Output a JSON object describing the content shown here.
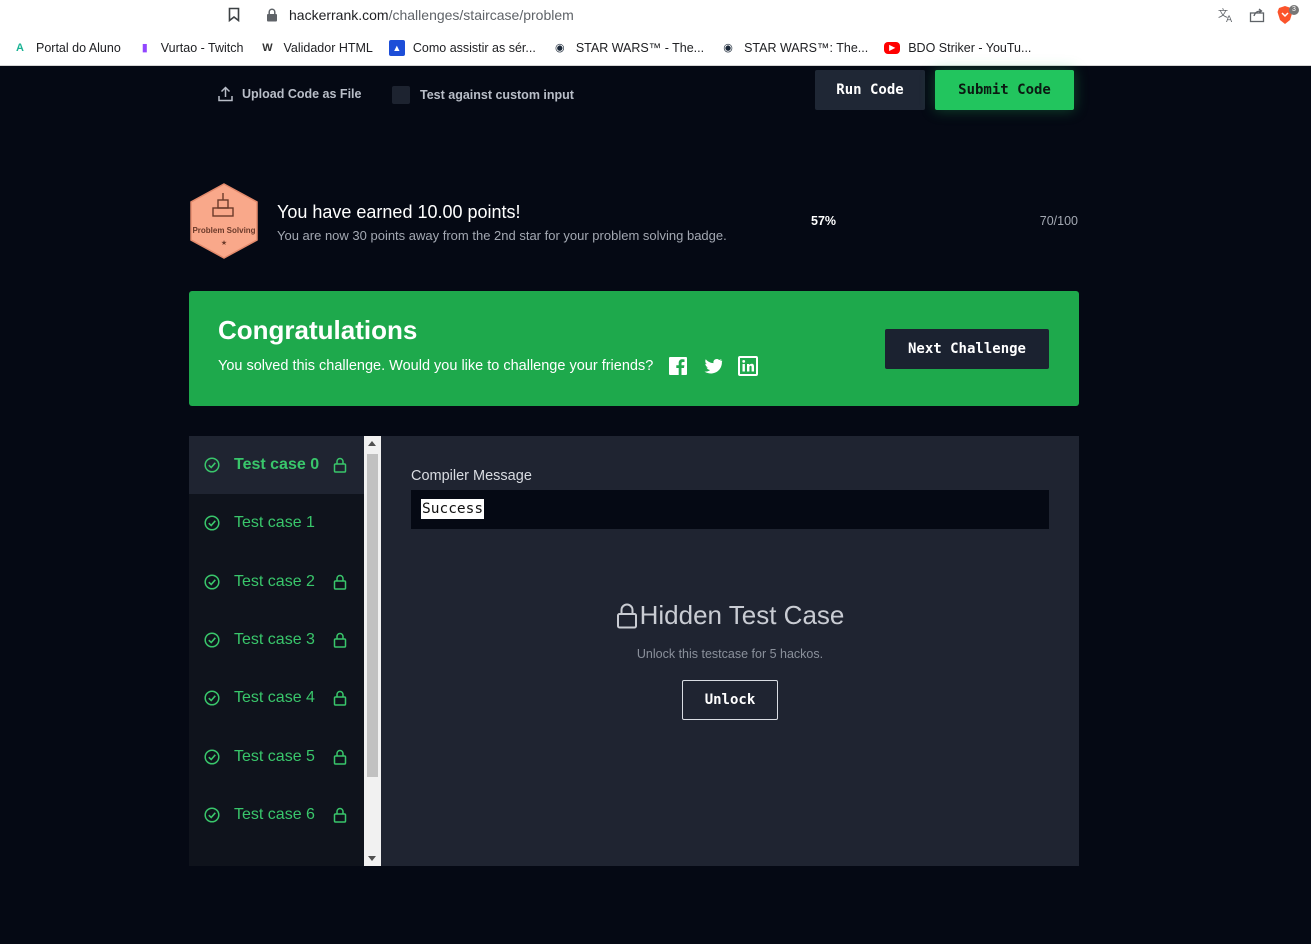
{
  "browser": {
    "url_host": "hackerrank.com",
    "url_path": "/challenges/staircase/problem",
    "extension_count": "3",
    "bookmarks": [
      {
        "label": "Portal do Aluno",
        "icon": "portal-a-icon",
        "color": "#1ab394"
      },
      {
        "label": "Vurtao - Twitch",
        "icon": "twitch-icon",
        "color": "#9146ff"
      },
      {
        "label": "Validador HTML",
        "icon": "w3c-icon",
        "color": "#333333"
      },
      {
        "label": "Como assistir as sér...",
        "icon": "bookmark-site-icon",
        "color": "#1d4ed8"
      },
      {
        "label": "STAR WARS™ - The...",
        "icon": "steam-icon",
        "color": "#1b2838"
      },
      {
        "label": "STAR WARS™: The...",
        "icon": "steam-icon",
        "color": "#1b2838"
      },
      {
        "label": "BDO Striker - YouTu...",
        "icon": "youtube-icon",
        "color": "#ff0000"
      }
    ]
  },
  "toolbar": {
    "upload_label": "Upload Code as File",
    "custom_input_label": "Test against custom input",
    "run_label": "Run Code",
    "submit_label": "Submit Code"
  },
  "badge": {
    "label": "Problem Solving",
    "color": "#f9a88a"
  },
  "points": {
    "title": "You have earned 10.00 points!",
    "subtitle": "You are now 30 points away from the 2nd star for your problem solving badge.",
    "percent": "57%",
    "score": "70/100"
  },
  "congrats": {
    "title": "Congratulations",
    "subtitle": "You solved this challenge. Would you like to challenge your friends?",
    "next_label": "Next Challenge",
    "color": "#1ea94c"
  },
  "test_cases": [
    {
      "label": "Test case 0",
      "locked": true,
      "active": true
    },
    {
      "label": "Test case 1",
      "locked": false,
      "active": false
    },
    {
      "label": "Test case 2",
      "locked": true,
      "active": false
    },
    {
      "label": "Test case 3",
      "locked": true,
      "active": false
    },
    {
      "label": "Test case 4",
      "locked": true,
      "active": false
    },
    {
      "label": "Test case 5",
      "locked": true,
      "active": false
    },
    {
      "label": "Test case 6",
      "locked": true,
      "active": false
    }
  ],
  "result": {
    "compiler_label": "Compiler Message",
    "compiler_message": "Success",
    "hidden_title": "Hidden Test Case",
    "hidden_subtitle": "Unlock this testcase for 5 hackos.",
    "unlock_label": "Unlock"
  }
}
